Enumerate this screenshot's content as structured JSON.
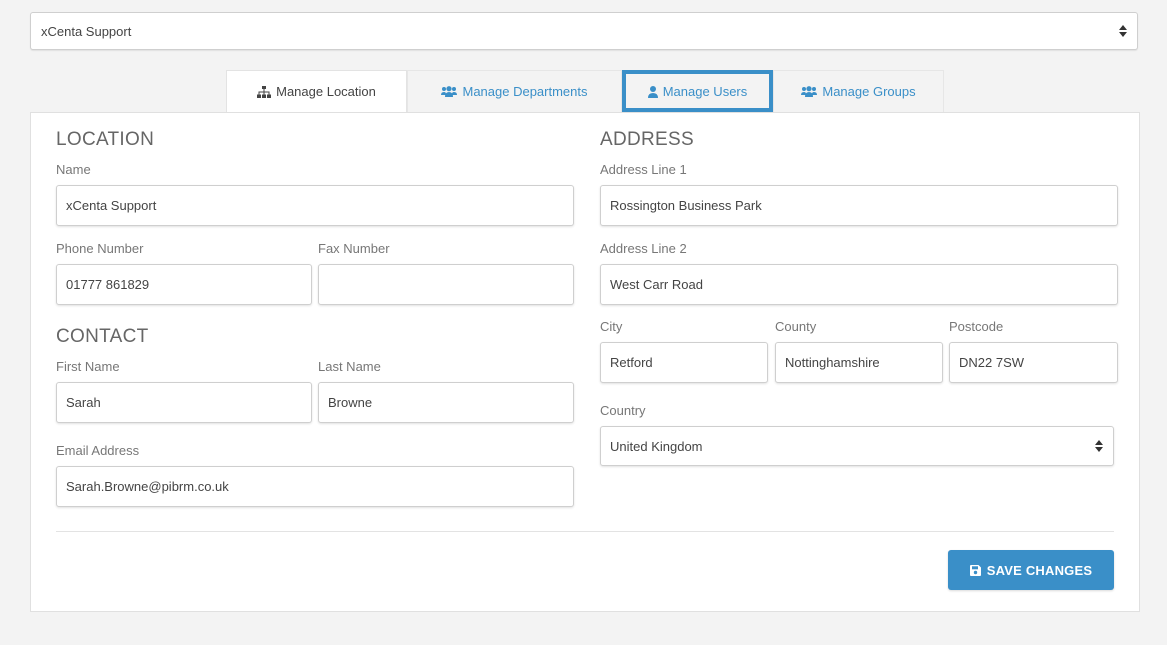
{
  "location_select": {
    "value": "xCenta Support"
  },
  "tabs": [
    {
      "label": "Manage Location",
      "icon": "sitemap-icon",
      "active": true
    },
    {
      "label": "Manage Departments",
      "icon": "users-icon",
      "active": false
    },
    {
      "label": "Manage Users",
      "icon": "user-icon",
      "active": false
    },
    {
      "label": "Manage Groups",
      "icon": "users-icon",
      "active": false
    }
  ],
  "location": {
    "title": "LOCATION",
    "name_label": "Name",
    "name_value": "xCenta Support",
    "phone_label": "Phone Number",
    "phone_value": "01777 861829",
    "fax_label": "Fax Number",
    "fax_value": ""
  },
  "contact": {
    "title": "CONTACT",
    "first_name_label": "First Name",
    "first_name_value": "Sarah",
    "last_name_label": "Last Name",
    "last_name_value": "Browne",
    "email_label": "Email Address",
    "email_value": "Sarah.Browne@pibrm.co.uk"
  },
  "address": {
    "title": "ADDRESS",
    "line1_label": "Address Line 1",
    "line1_value": "Rossington Business Park",
    "line2_label": "Address Line 2",
    "line2_value": "West Carr Road",
    "city_label": "City",
    "city_value": "Retford",
    "county_label": "County",
    "county_value": "Nottinghamshire",
    "postcode_label": "Postcode",
    "postcode_value": "DN22 7SW",
    "country_label": "Country",
    "country_value": "United Kingdom"
  },
  "save_button": {
    "label": "SAVE CHANGES",
    "icon": "save-icon"
  },
  "colors": {
    "accent": "#3a8fc8",
    "background": "#f3f3f3"
  }
}
